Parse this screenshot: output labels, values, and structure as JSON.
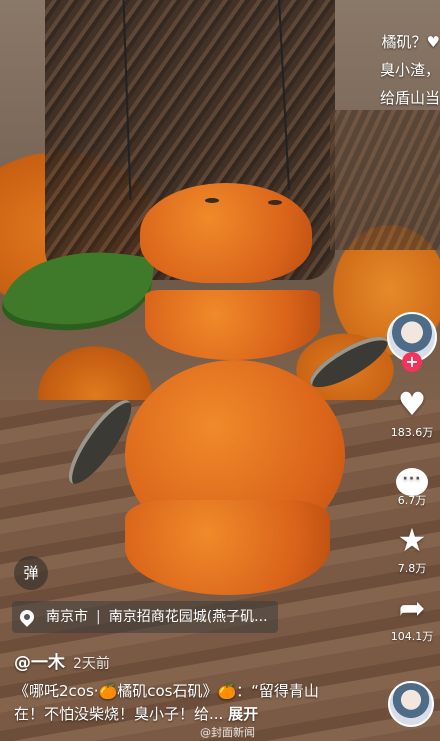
{
  "overlay_caption": {
    "lines": [
      "橘矶？",
      "臭小渣，",
      "给盾山当"
    ]
  },
  "actions": {
    "like_count": "183.6万",
    "comment_count": "6.7万",
    "favorite_count": "7.8万",
    "share_count": "104.1万"
  },
  "danmu_button": "弹",
  "location": {
    "city": "南京市",
    "place": "南京招商花园城(燕子矶..."
  },
  "author": {
    "handle": "@一木",
    "time": "2天前"
  },
  "description": {
    "text": "《哪吒2cos·🍊橘矶cos石矶》🍊：“留得青山在！不怕没柴烧！臭小子！给...",
    "expand_label": "展开"
  },
  "watermark": "@封面新闻",
  "colors": {
    "follow_badge": "#f2335c"
  }
}
